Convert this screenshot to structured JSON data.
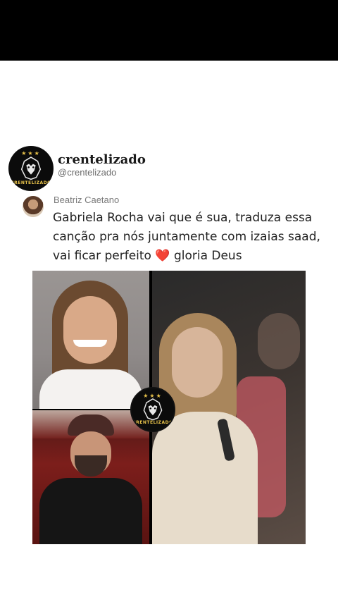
{
  "post": {
    "account_name": "crentelizado",
    "handle": "@crentelizado",
    "logo_text": "CRENTELIZADO"
  },
  "comment": {
    "author": "Beatriz Caetano",
    "text_before_heart": "Gabriela Rocha vai que é sua, traduza essa canção pra nós juntamente com izaias saad, vai ficar perfeito",
    "heart": "❤️",
    "text_after_heart": "gloria Deus"
  },
  "colors": {
    "brand_gold": "#e8c24a",
    "heart_red": "#e0162b"
  }
}
